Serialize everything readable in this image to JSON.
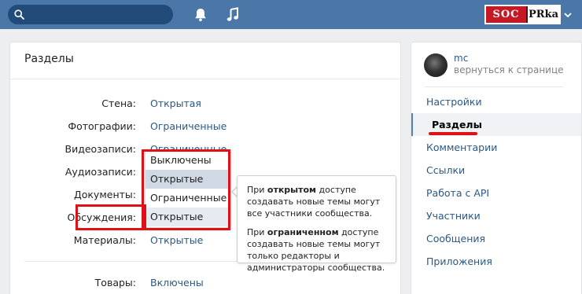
{
  "topbar": {
    "search_placeholder": "",
    "icons": [
      "search-icon",
      "bell-icon",
      "music-icon",
      "chevron-down-icon"
    ],
    "logo": {
      "left": "SOC",
      "right": "PRka"
    }
  },
  "section": {
    "title": "Разделы",
    "rows": [
      {
        "label": "Стена:",
        "value": "Открытая"
      },
      {
        "label": "Фотографии:",
        "value": "Ограниченные"
      },
      {
        "label": "Видеозаписи:",
        "value": "Ограниченные"
      },
      {
        "label": "Аудиозаписи:",
        "value": ""
      },
      {
        "label": "Документы:",
        "value": ""
      },
      {
        "label": "Обсуждения:",
        "value": "Открытые"
      },
      {
        "label": "Материалы:",
        "value": "Открытые"
      },
      {
        "label": "Товары:",
        "value": "Включены"
      }
    ]
  },
  "dropdown": {
    "options": [
      "Выключены",
      "Открытые",
      "Ограниченные",
      "Открытые"
    ],
    "hovered_index": 1,
    "selected_index": 3
  },
  "tooltip": {
    "p1_before": "При ",
    "p1_bold": "открытом",
    "p1_after": " доступе создавать новые темы могут все участники сообщества.",
    "p2_before": "При ",
    "p2_bold": "ограниченном",
    "p2_after": " доступе создавать новые темы могут только редакторы и администраторы сообщества."
  },
  "sidebar": {
    "group_name": "mc",
    "back_link": "вернуться к странице",
    "items": [
      {
        "label": "Настройки",
        "active": false
      },
      {
        "label": "Разделы",
        "active": true
      },
      {
        "label": "Комментарии",
        "active": false
      },
      {
        "label": "Ссылки",
        "active": false
      },
      {
        "label": "Работа с API",
        "active": false
      },
      {
        "label": "Участники",
        "active": false
      },
      {
        "label": "Сообщения",
        "active": false
      },
      {
        "label": "Приложения",
        "active": false
      }
    ]
  },
  "colors": {
    "header": "#4a76a8",
    "link": "#2a5885",
    "highlight": "#e01018",
    "logo_red": "#c51a25"
  }
}
